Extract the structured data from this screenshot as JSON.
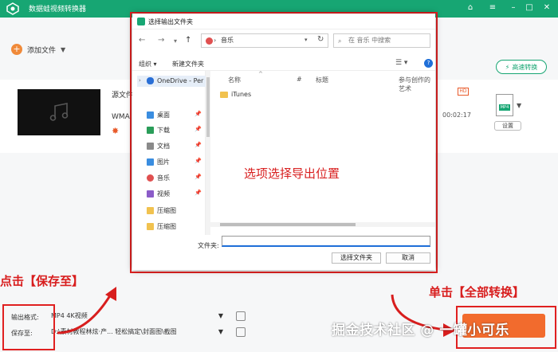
{
  "app": {
    "title": "数据蛙视频转换器",
    "add_file": "添加文件",
    "fast_convert": "高速转换"
  },
  "file": {
    "source_label": "源文件",
    "format_label": "WMA",
    "duration": "00:02:17",
    "settings_label": "设置",
    "target_badge": "MP4"
  },
  "output": {
    "format_label": "输出格式:",
    "format_value": "MP4 4K视频",
    "save_to_label": "保存至:",
    "save_path": "D:\\素材教程林炫·产...  轻松搞定\\封面图\\截图"
  },
  "dialog": {
    "title": "选择输出文件夹",
    "address": "音乐",
    "search_placeholder": "在 音乐 中搜索",
    "organize": "组织 ▾",
    "new_folder": "新建文件夹",
    "nav_items": [
      {
        "label": "OneDrive - Per",
        "color": "#2a6fd6"
      },
      {
        "label": "桌面",
        "color": "#3a8de0"
      },
      {
        "label": "下载",
        "color": "#2a9d59"
      },
      {
        "label": "文档",
        "color": "#8a8a8a"
      },
      {
        "label": "图片",
        "color": "#3a8de0"
      },
      {
        "label": "音乐",
        "color": "#e05050"
      },
      {
        "label": "视频",
        "color": "#8b5cc8"
      },
      {
        "label": "压缩图",
        "color": "#f1c24f"
      },
      {
        "label": "压缩图",
        "color": "#f1c24f"
      }
    ],
    "columns": [
      "名称",
      "#",
      "标题",
      "参与创作的艺术"
    ],
    "items": [
      "iTunes"
    ],
    "folder_label": "文件夹:",
    "select_button": "选择文件夹",
    "cancel_button": "取消"
  },
  "annotations": {
    "center": "选项选择导出位置",
    "left": "点击【保存至】",
    "right": "单击【全部转换】",
    "watermark": "掘金技术社区 @ 一罐小可乐"
  },
  "colors": {
    "brand": "#17a673",
    "accent": "#f26b2d",
    "annotation": "#d81e1e"
  }
}
